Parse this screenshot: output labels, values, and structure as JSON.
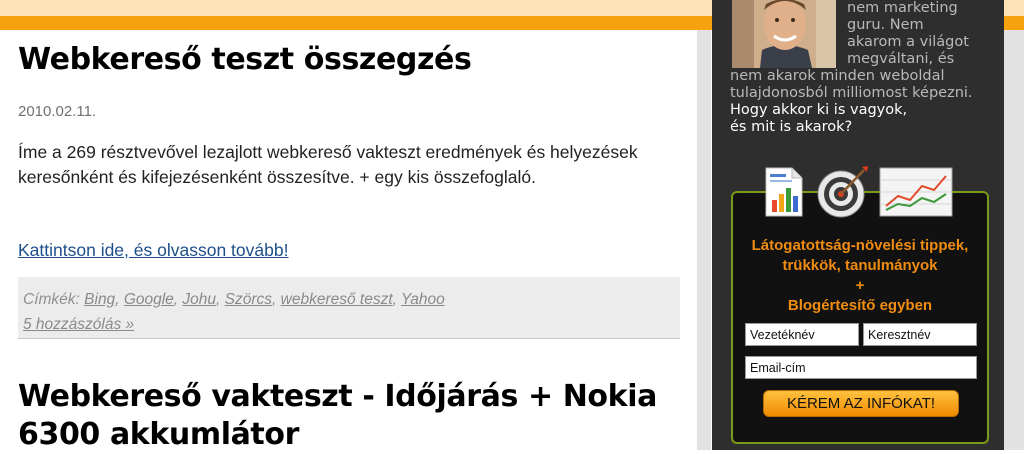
{
  "posts": [
    {
      "title": "Webkereső teszt összegzés",
      "date": "2010.02.11.",
      "excerpt": "Íme a 269 résztvevővel lezajlott webkereső vakteszt eredmények és helyezések keresőnként és kifejezésenként összesítve. + egy kis összefoglaló.",
      "read_more": "Kattintson ide, és olvasson tovább!",
      "tags_label": "Címkék:",
      "tags": [
        "Bing",
        "Google",
        "Johu",
        "Szörcs",
        "webkereső teszt",
        "Yahoo"
      ],
      "comments": "5 hozzászólás »"
    },
    {
      "title": "Webkereső vakteszt - Időjárás + Nokia 6300 akkumlátor"
    }
  ],
  "sidebar": {
    "about_lines": [
      "nem marketing",
      "guru. Nem",
      "akarom a világot",
      "megváltani, és",
      "nem akarok minden weboldal",
      "tulajdonosból milliomost képezni."
    ],
    "about_highlight_lines": [
      "Hogy akkor ki is vagyok,",
      "és mit is akarok?"
    ],
    "icons": [
      "document-chart-icon",
      "target-icon",
      "line-chart-icon"
    ],
    "promo": {
      "line1": "Látogatottság-növelési tippek,",
      "line2": "trükkök, tanulmányok",
      "plus": "+",
      "line3": "Blogértesítő egyben",
      "lastname_placeholder": "Vezetéknév",
      "firstname_placeholder": "Keresztnév",
      "email_placeholder": "Email-cím",
      "button": "KÉREM AZ INFÓKAT!"
    }
  },
  "colors": {
    "accent_orange": "#f6a10e",
    "promo_text": "#f08c10",
    "promo_border": "#7a9b19",
    "link_blue": "#1d4f8a"
  }
}
